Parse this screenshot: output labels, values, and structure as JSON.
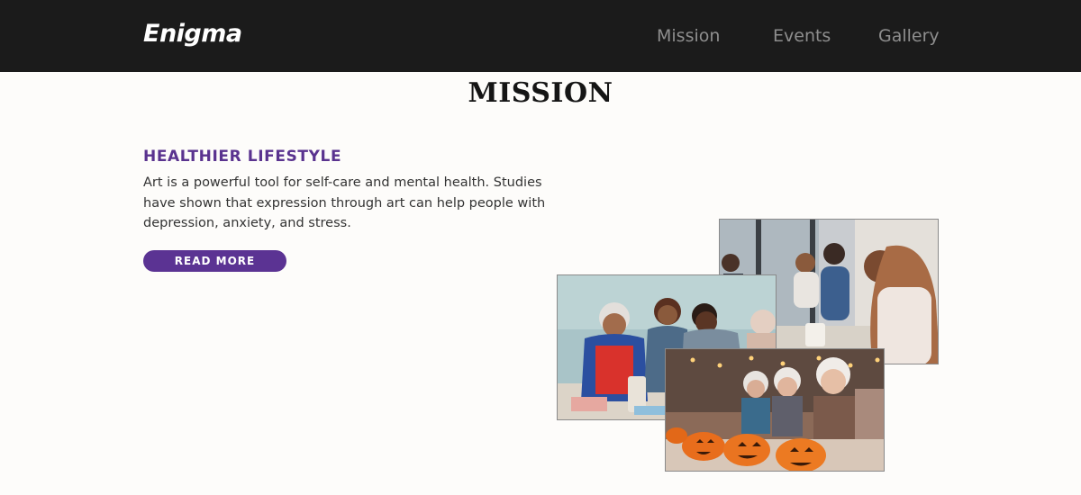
{
  "header": {
    "brand": "Enigma",
    "nav": [
      {
        "label": "Mission"
      },
      {
        "label": "Events"
      },
      {
        "label": "Gallery"
      }
    ]
  },
  "page": {
    "title": "MISSION"
  },
  "section": {
    "heading": "HEALTHIER LIFESTYLE",
    "body": "Art is a powerful tool for self-care and mental health. Studies have shown that expression through art can help people with depression, anxiety, and stress.",
    "button_label": "READ MORE"
  },
  "colors": {
    "navbar_bg": "#1b1b1b",
    "accent_purple": "#5b3393",
    "page_bg": "#fdfcfa"
  }
}
